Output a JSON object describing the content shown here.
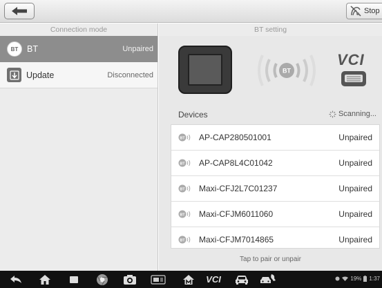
{
  "toolbar": {
    "back_icon": "back-arrow-icon",
    "stop_icon": "stop-icon",
    "stop_label": "Stop"
  },
  "left_panel": {
    "header": "Connection mode",
    "modes": [
      {
        "icon": "bluetooth-icon",
        "icon_text": "BT",
        "name": "BT",
        "status": "Unpaired",
        "selected": true
      },
      {
        "icon": "update-icon",
        "icon_text": "",
        "name": "Update",
        "status": "Disconnected",
        "selected": false
      }
    ]
  },
  "right_panel": {
    "header": "BT setting",
    "hero": {
      "tablet_icon": "tablet-icon",
      "signal_icon": "bluetooth-signal-icon",
      "signal_text": "BT",
      "vci_label": "VCI",
      "vci_icon": "vci-device-icon"
    },
    "devices_label": "Devices",
    "scanning_label": "Scanning...",
    "devices": [
      {
        "icon": "bt-device-icon",
        "name": "AP-CAP280501001",
        "status": "Unpaired"
      },
      {
        "icon": "bt-device-icon",
        "name": "AP-CAP8L4C01042",
        "status": "Unpaired"
      },
      {
        "icon": "bt-device-icon",
        "name": "Maxi-CFJ2L7C01237",
        "status": "Unpaired"
      },
      {
        "icon": "bt-device-icon",
        "name": "Maxi-CFJM6011060",
        "status": "Unpaired"
      },
      {
        "icon": "bt-device-icon",
        "name": "Maxi-CFJM7014865",
        "status": "Unpaired"
      }
    ],
    "hint": "Tap to pair or unpair"
  },
  "navbar": {
    "items": [
      "back-icon",
      "home-icon",
      "recent-apps-icon",
      "chrome-icon",
      "camera-icon",
      "screen-icon",
      "maxisys-home-icon",
      "vci-icon",
      "car-icon",
      "car-service-icon"
    ],
    "vci_text": "VCI",
    "battery_text": "19%",
    "clock": "1:37"
  },
  "colors": {
    "selected_row": "#8d8d8d",
    "panel_bg": "#ececec",
    "navbar_bg": "#111111"
  }
}
